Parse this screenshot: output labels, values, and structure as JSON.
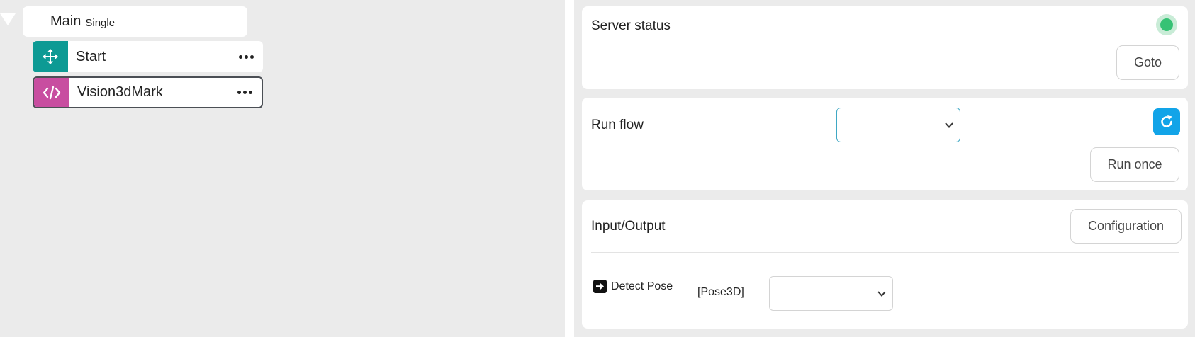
{
  "tree": {
    "root_title": "Main",
    "root_subtitle": "Single",
    "nodes": [
      {
        "label": "Start",
        "icon": "move-arrows-icon",
        "color": "#0d9a94",
        "selected": false
      },
      {
        "label": "Vision3dMark",
        "icon": "code-icon",
        "color": "#c84ea0",
        "selected": true
      }
    ]
  },
  "server": {
    "title": "Server status",
    "status_color": "#36c275",
    "goto_label": "Goto"
  },
  "run": {
    "title": "Run flow",
    "flow_value": "",
    "run_once_label": "Run once"
  },
  "io": {
    "title": "Input/Output",
    "configuration_label": "Configuration",
    "items": [
      {
        "name": "Detect Pose",
        "type": "[Pose3D]",
        "value": ""
      }
    ]
  },
  "colors": {
    "accent": "#12a4e8",
    "panel_bg": "#ebebeb"
  }
}
